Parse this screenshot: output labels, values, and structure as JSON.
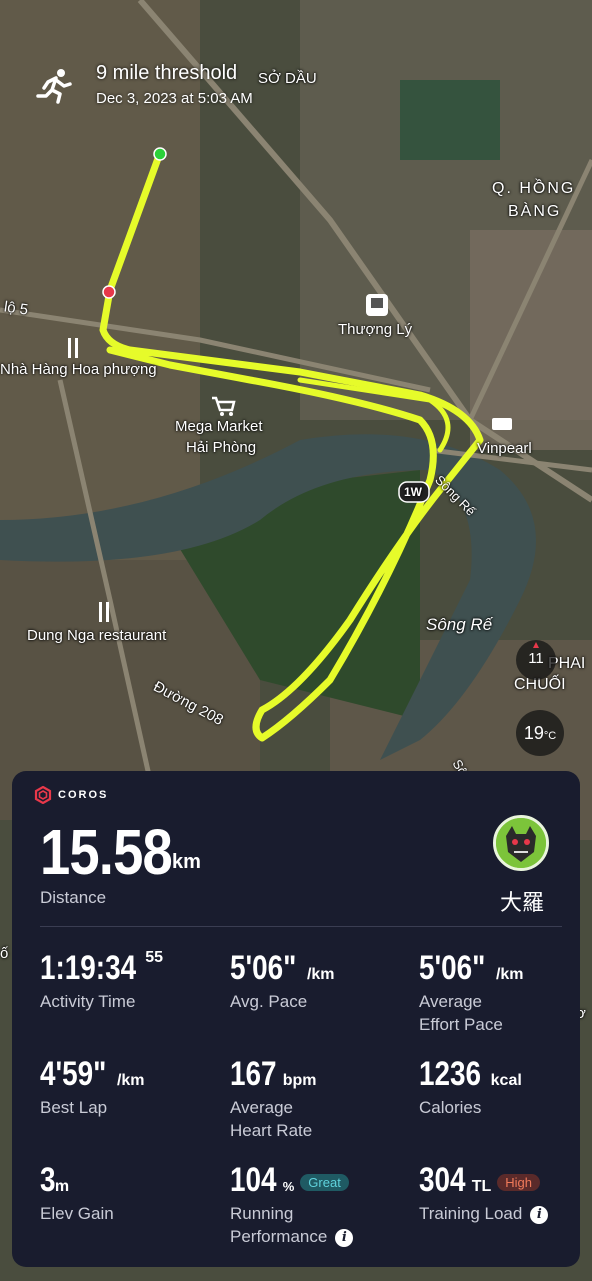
{
  "activity": {
    "title": "9 mile threshold",
    "date": "Dec 3, 2023 at 5:03 AM",
    "type_icon": "running-person-icon"
  },
  "map": {
    "labels": {
      "so_dau": "SỞ DẦU",
      "q_hong_bang_1": "Q. HỒNG",
      "q_hong_bang_2": "BÀNG",
      "lo5": "lộ 5",
      "thuong_ly": "Thượng Lý",
      "nha_hang": "Nhà Hàng Hoa phượng",
      "mega_market_1": "Mega Market",
      "mega_market_2": "Hải Phòng",
      "vinpearl": "Vinpearl",
      "road_1w": "1W",
      "song_re_1": "Sông Rế",
      "song_re_2": "Sông Rế",
      "dung_nga": "Dung Nga restaurant",
      "duong_208": "Đường 208",
      "phai_chuoi_1": "PHAI",
      "phai_chuoi_2": "CHUỐI",
      "edge_lo": "ố",
      "edge_o": "ơ",
      "edge_s": "Sô"
    },
    "compass_value": "11",
    "temperature": "19",
    "temperature_unit": "°C",
    "route_color": "#e6fb2a",
    "start_color": "#2bd13a",
    "end_color": "#e8384a"
  },
  "summary": {
    "brand": "COROS",
    "distance": "15.58",
    "distance_unit": "km",
    "distance_label": "Distance",
    "user_name": "大羅",
    "stats": {
      "activity_time": {
        "value": "1:19:34",
        "sup": "55",
        "label": "Activity Time"
      },
      "avg_pace": {
        "value": "5'06\"",
        "unit": "/km",
        "label": "Avg. Pace"
      },
      "avg_effort_pace": {
        "value": "5'06\"",
        "unit": "/km",
        "label_1": "Average",
        "label_2": "Effort Pace"
      },
      "best_lap": {
        "value": "4'59\"",
        "unit": "/km",
        "label": "Best Lap"
      },
      "avg_hr": {
        "value": "167",
        "unit": "bpm",
        "label_1": "Average",
        "label_2": "Heart Rate"
      },
      "calories": {
        "value": "1236",
        "unit": "kcal",
        "label": "Calories"
      },
      "elev_gain": {
        "value": "3",
        "unit": "m",
        "label": "Elev Gain"
      },
      "running_perf": {
        "value": "104",
        "unit": "%",
        "badge": "Great",
        "label_1": "Running",
        "label_2": "Performance"
      },
      "training_load": {
        "value": "304",
        "unit": "TL",
        "badge": "High",
        "label": "Training Load"
      }
    },
    "colors": {
      "card_bg": "#191c2e",
      "badge_great_bg": "#1f5a63",
      "badge_great_fg": "#5fd2dc",
      "badge_high_bg": "#5a2a2a",
      "badge_high_fg": "#f07a5a"
    }
  }
}
